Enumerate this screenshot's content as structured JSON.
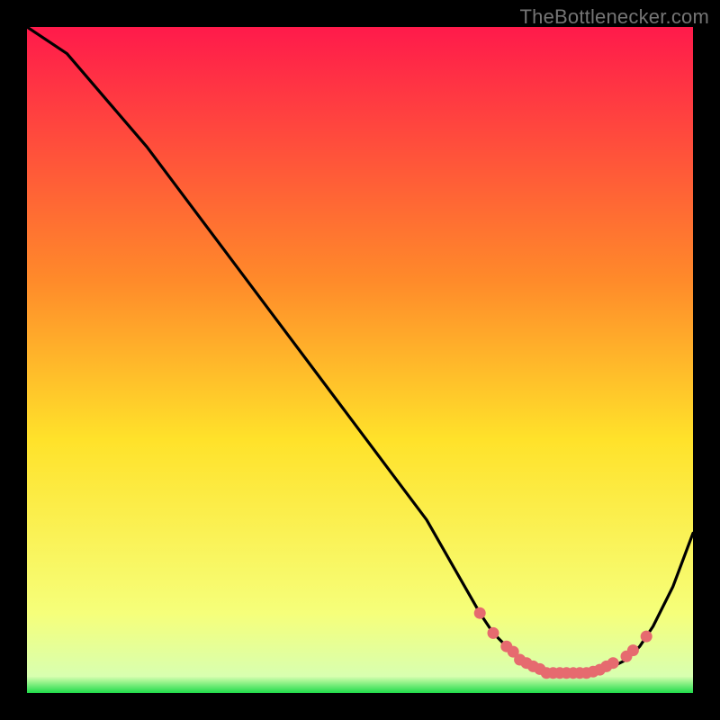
{
  "watermark": "TheBottlenecker.com",
  "colors": {
    "bg": "#000000",
    "grad_top": "#ff1a4b",
    "grad_mid1": "#ff8a2a",
    "grad_mid2": "#ffe22a",
    "grad_low": "#f6ff7a",
    "grad_green": "#1fdc4a",
    "line": "#000000",
    "marker": "#e66a6f"
  },
  "chart_data": {
    "type": "line",
    "title": "",
    "xlabel": "",
    "ylabel": "",
    "xlim": [
      0,
      100
    ],
    "ylim": [
      0,
      100
    ],
    "grid": false,
    "series": [
      {
        "name": "curve",
        "x": [
          0,
          6,
          12,
          18,
          24,
          30,
          36,
          42,
          48,
          54,
          60,
          64,
          68,
          70,
          72,
          74,
          76,
          78,
          80,
          82,
          84,
          86,
          88,
          90,
          92,
          94,
          97,
          100
        ],
        "y": [
          100,
          96,
          89,
          82,
          74,
          66,
          58,
          50,
          42,
          34,
          26,
          19,
          12,
          9,
          7,
          5,
          4,
          3,
          3,
          3,
          3,
          3,
          4,
          5,
          7,
          10,
          16,
          24
        ]
      }
    ],
    "markers": {
      "name": "bottleneck-points",
      "x": [
        68,
        70,
        72,
        73,
        74,
        75,
        76,
        77,
        78,
        79,
        80,
        81,
        82,
        83,
        84,
        85,
        86,
        87,
        88,
        90,
        91,
        93
      ],
      "y": [
        12,
        9,
        7,
        6.2,
        5,
        4.5,
        4,
        3.6,
        3,
        3,
        3,
        3,
        3,
        3,
        3,
        3.2,
        3.5,
        4,
        4.5,
        5.5,
        6.4,
        8.5
      ]
    }
  }
}
